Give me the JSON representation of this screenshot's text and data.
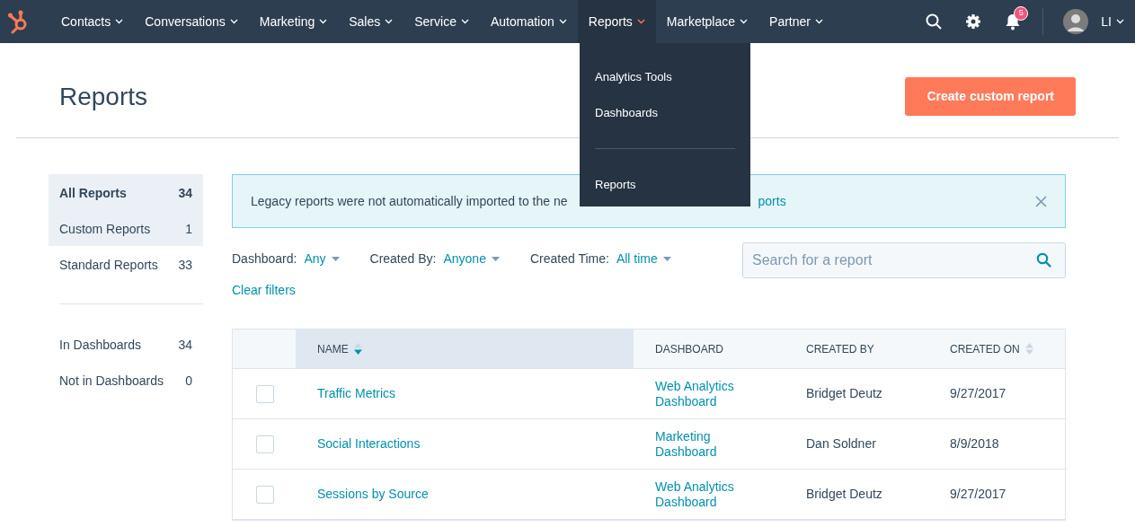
{
  "nav": {
    "items": [
      {
        "label": "Contacts",
        "selected": false
      },
      {
        "label": "Conversations",
        "selected": false
      },
      {
        "label": "Marketing",
        "selected": false
      },
      {
        "label": "Sales",
        "selected": false
      },
      {
        "label": "Service",
        "selected": false
      },
      {
        "label": "Automation",
        "selected": false
      },
      {
        "label": "Reports",
        "selected": true
      },
      {
        "label": "Marketplace",
        "selected": false
      },
      {
        "label": "Partner",
        "selected": false
      }
    ],
    "notification_count": "5",
    "user_initials": "LI"
  },
  "dropdown": {
    "items": [
      {
        "kind": "item",
        "label": "Analytics Tools"
      },
      {
        "kind": "item",
        "label": "Dashboards"
      },
      {
        "kind": "divider"
      },
      {
        "kind": "item",
        "label": "Reports"
      }
    ]
  },
  "page_title": "Reports",
  "create_button": "Create custom report",
  "sidebar": {
    "groups": [
      [
        {
          "label": "All Reports",
          "count": "34",
          "selected": true,
          "hovered": false
        },
        {
          "label": "Custom Reports",
          "count": "1",
          "selected": false,
          "hovered": true
        },
        {
          "label": "Standard Reports",
          "count": "33",
          "selected": false,
          "hovered": false
        }
      ],
      [
        {
          "label": "In Dashboards",
          "count": "34",
          "selected": false,
          "hovered": false
        },
        {
          "label": "Not in Dashboards",
          "count": "0",
          "selected": false,
          "hovered": false
        }
      ]
    ]
  },
  "alert": {
    "text": "Legacy reports were not automatically imported to the ne",
    "link": "ports"
  },
  "filters": [
    {
      "label": "Dashboard:",
      "value": "Any"
    },
    {
      "label": "Created By:",
      "value": "Anyone"
    },
    {
      "label": "Created Time:",
      "value": "All time"
    }
  ],
  "clear_filters": "Clear filters",
  "search": {
    "placeholder": "Search for a report"
  },
  "table": {
    "columns": [
      {
        "label": "NAME",
        "sortable": true,
        "sorted": true
      },
      {
        "label": "DASHBOARD",
        "sortable": false,
        "sorted": false
      },
      {
        "label": "CREATED BY",
        "sortable": false,
        "sorted": false
      },
      {
        "label": "CREATED ON",
        "sortable": true,
        "sorted": false
      }
    ],
    "rows": [
      {
        "checked": false,
        "name": "Traffic Metrics",
        "dashboard": "Web Analytics Dashboard",
        "created_by": "Bridget Deutz",
        "created_on": "9/27/2017"
      },
      {
        "checked": false,
        "name": "Social Interactions",
        "dashboard": "Marketing Dashboard",
        "created_by": "Dan Soldner",
        "created_on": "8/9/2018"
      },
      {
        "checked": false,
        "name": "Sessions by Source",
        "dashboard": "Web Analytics Dashboard",
        "created_by": "Bridget Deutz",
        "created_on": "9/27/2017"
      }
    ]
  }
}
